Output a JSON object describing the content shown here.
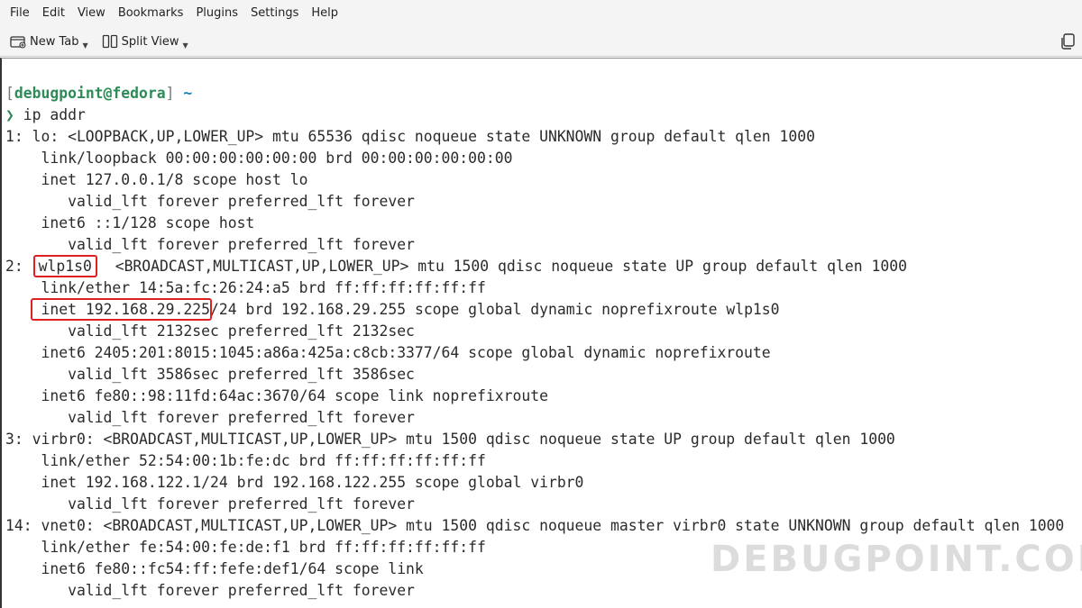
{
  "menu": [
    "File",
    "Edit",
    "View",
    "Bookmarks",
    "Plugins",
    "Settings",
    "Help"
  ],
  "toolbar": {
    "new_tab_label": "New Tab",
    "split_view_label": "Split View",
    "icons": [
      "new-tab-icon",
      "split-view-icon",
      "copy-icon"
    ]
  },
  "terminal": {
    "prompt_open": "[",
    "prompt_user_host": "debugpoint@fedora",
    "prompt_close": "]",
    "prompt_dir": "~",
    "prompt_arrow": "❯",
    "command": " ip addr",
    "lines": [
      "1: lo: <LOOPBACK,UP,LOWER_UP> mtu 65536 qdisc noqueue state UNKNOWN group default qlen 1000",
      "    link/loopback 00:00:00:00:00:00 brd 00:00:00:00:00:00",
      "    inet 127.0.0.1/8 scope host lo",
      "       valid_lft forever preferred_lft forever",
      "    inet6 ::1/128 scope host",
      "       valid_lft forever preferred_lft forever"
    ],
    "wlp_prefix": "2: ",
    "wlp_iface": "wlp1s0",
    "wlp_rest": " <BROADCAST,MULTICAST,UP,LOWER_UP> mtu 1500 qdisc noqueue state UP group default qlen 1000",
    "wlp_link": "    link/ether 14:5a:fc:26:24:a5 brd ff:ff:ff:ff:ff:ff",
    "wlp_inet_indent": "    ",
    "wlp_inet_ip": "inet 192.168.29.225",
    "wlp_inet_rest": "/24 brd 192.168.29.255 scope global dynamic noprefixroute wlp1s0",
    "lines2": [
      "       valid_lft 2132sec preferred_lft 2132sec",
      "    inet6 2405:201:8015:1045:a86a:425a:c8cb:3377/64 scope global dynamic noprefixroute",
      "       valid_lft 3586sec preferred_lft 3586sec",
      "    inet6 fe80::98:11fd:64ac:3670/64 scope link noprefixroute",
      "       valid_lft forever preferred_lft forever",
      "3: virbr0: <BROADCAST,MULTICAST,UP,LOWER_UP> mtu 1500 qdisc noqueue state UP group default qlen 1000",
      "    link/ether 52:54:00:1b:fe:dc brd ff:ff:ff:ff:ff:ff",
      "    inet 192.168.122.1/24 brd 192.168.122.255 scope global virbr0",
      "       valid_lft forever preferred_lft forever",
      "14: vnet0: <BROADCAST,MULTICAST,UP,LOWER_UP> mtu 1500 qdisc noqueue master virbr0 state UNKNOWN group default qlen 1000",
      "    link/ether fe:54:00:fe:de:f1 brd ff:ff:ff:ff:ff:ff",
      "    inet6 fe80::fc54:ff:fefe:def1/64 scope link",
      "       valid_lft forever preferred_lft forever"
    ]
  },
  "watermark": "DEBUGPOINT.COM",
  "colors": {
    "highlight": "#e02020",
    "prompt_green": "#2e8b57",
    "prompt_blue": "#1a7fb7"
  }
}
